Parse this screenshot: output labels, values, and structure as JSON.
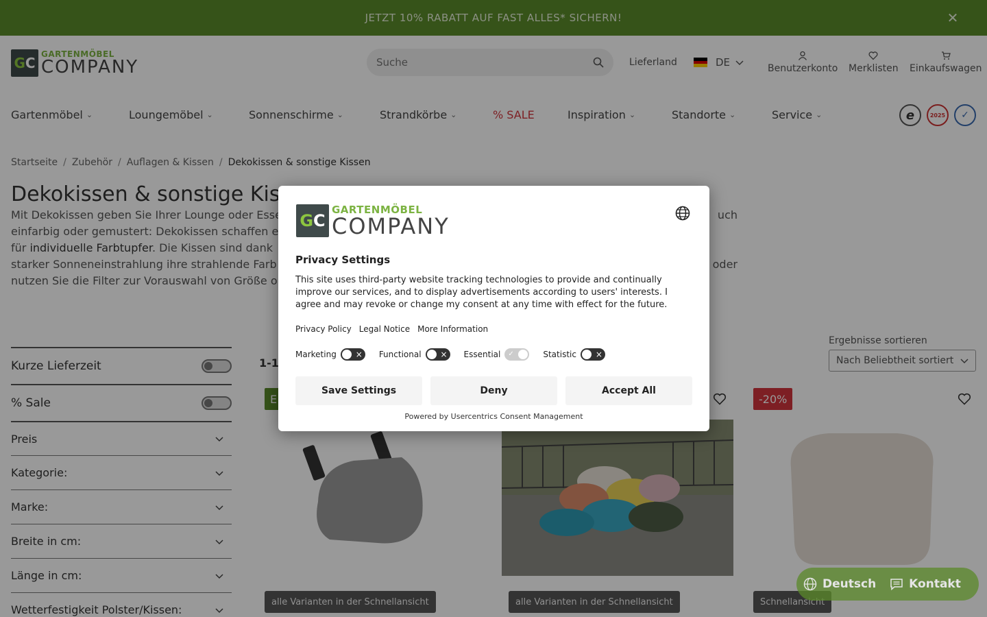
{
  "promo": {
    "text": "JETZT 10% RABATT AUF FAST ALLES* SICHERN!"
  },
  "logo": {
    "mark": "GC",
    "top": "GARTENMÖBEL",
    "bottom": "COMPANY"
  },
  "search": {
    "placeholder": "Suche"
  },
  "header": {
    "lieferland": "Lieferland",
    "country": "DE",
    "actions": [
      "Benutzerkonto",
      "Merklisten",
      "Einkaufswagen"
    ]
  },
  "nav": {
    "items": [
      "Gartenmöbel",
      "Loungemöbel",
      "Sonnenschirme",
      "Strandkörbe",
      "% SALE",
      "Inspiration",
      "Standorte",
      "Service"
    ],
    "badges": [
      "e",
      "2025",
      "✓"
    ]
  },
  "breadcrumb": [
    "Startseite",
    "Zubehör",
    "Auflagen & Kissen",
    "Dekokissen & sonstige Kissen"
  ],
  "page": {
    "title": "Dekokissen & sonstige Kis",
    "intro_1": "Mit Dekokissen geben Sie Ihrer Lounge oder Esse",
    "intro_1b": "uch",
    "intro_2": "einfarbig oder gemustert: Dekokissen schaffen e",
    "intro_3a": "für ",
    "intro_3b": "individuelle Farbtupfer",
    "intro_3c": ". Die Kissen sind dank",
    "intro_4": "starker Sonneneinstrahlung ihre strahlende Farb",
    "intro_4b": "oder",
    "intro_5": "nutzen Sie die Filter zur Vorauswahl von Größe o"
  },
  "filters": {
    "toggles": [
      "Kurze Lieferzeit",
      "% Sale"
    ],
    "accordions": [
      "Preis",
      "Kategorie:",
      "Marke:",
      "Breite in cm:",
      "Länge in cm:",
      "Wetterfestigkeit Polster/Kissen:"
    ]
  },
  "results": {
    "count": "1-1",
    "sort_label": "Ergebnisse sortieren",
    "sort_value": "Nach Beliebtheit sortiert"
  },
  "products": [
    {
      "badge": "E",
      "badge_color": "#5b8a2a",
      "quick": "alle Varianten in der Schnellansicht"
    },
    {
      "badge": "",
      "badge_color": "",
      "quick": "alle Varianten in der Schnellansicht"
    },
    {
      "badge": "-20%",
      "badge_color": "#d0343c",
      "quick": "Schnellansicht"
    }
  ],
  "consent": {
    "logo_top": "GARTENMÖBEL",
    "logo_bottom": "COMPANY",
    "title": "Privacy Settings",
    "text": "This site uses third-party website tracking technologies to provide and continually improve our services, and to display advertisements according to users' interests. I agree and may revoke or change my consent at any time with effect for the future.",
    "links": [
      "Privacy Policy",
      "Legal Notice",
      "More Information"
    ],
    "toggles": [
      {
        "label": "Marketing",
        "on": false
      },
      {
        "label": "Functional",
        "on": false
      },
      {
        "label": "Essential",
        "on": true
      },
      {
        "label": "Statistic",
        "on": false
      }
    ],
    "buttons": [
      "Save Settings",
      "Deny",
      "Accept All"
    ],
    "powered": "Powered by Usercentrics Consent Management"
  },
  "widget": {
    "language": "Deutsch",
    "contact": "Kontakt"
  },
  "colors": {
    "brand_green": "#5b8a2a",
    "sale_red": "#d0343c",
    "logo_green": "#7cb342"
  }
}
